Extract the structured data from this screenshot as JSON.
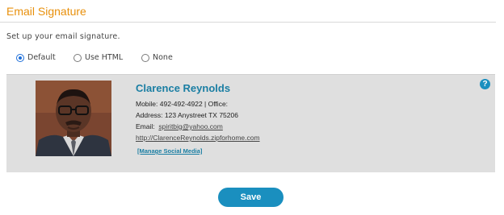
{
  "header": {
    "title": "Email Signature"
  },
  "intro": "Set up your email signature.",
  "signature_options": [
    {
      "label": "Default",
      "checked": true
    },
    {
      "label": "Use HTML",
      "checked": false
    },
    {
      "label": "None",
      "checked": false
    }
  ],
  "preview": {
    "name": "Clarence Reynolds",
    "mobile_line": "Mobile: 492-492-4922  | Office:",
    "address_line": "Address: 123 Anystreet TX 75206",
    "email_label": "Email:",
    "email": "spiritbig@yahoo.com",
    "website": "http://ClarenceReynolds.zipforhome.com",
    "manage_social": "[Manage Social Media]",
    "help_symbol": "?"
  },
  "actions": {
    "save_label": "Save"
  },
  "colors": {
    "title": "#e8900c",
    "accent": "#1a8fbf",
    "name": "#1a7ea3",
    "panel": "#dfdfdf"
  },
  "icons": {
    "help": "help-icon",
    "photo": "profile-photo"
  }
}
